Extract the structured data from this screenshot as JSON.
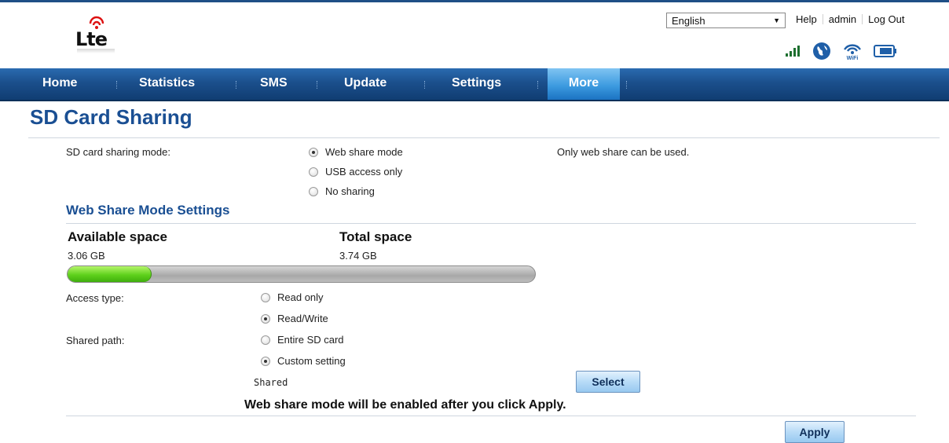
{
  "header": {
    "language": {
      "selected": "English"
    },
    "links": [
      "Help",
      "admin",
      "Log Out"
    ],
    "status_icons": [
      "signal-strength-icon",
      "internet-globe-icon",
      "wifi-icon",
      "battery-icon"
    ],
    "logo_icon": "lte-logo"
  },
  "nav": {
    "items": [
      {
        "label": "Home"
      },
      {
        "label": "Statistics"
      },
      {
        "label": "SMS"
      },
      {
        "label": "Update"
      },
      {
        "label": "Settings"
      },
      {
        "label": "More"
      }
    ],
    "active": "More"
  },
  "page": {
    "title": "SD Card Sharing",
    "sharing_mode": {
      "label": "SD card sharing mode:",
      "options": [
        "Web share mode",
        "USB access only",
        "No sharing"
      ],
      "selected": "Web share mode",
      "hint": "Only web share can be used."
    },
    "web_share": {
      "title": "Web Share Mode Settings",
      "available_label": "Available space",
      "available_value": "3.06 GB",
      "total_label": "Total space",
      "total_value": "3.74 GB",
      "used_fraction": 0.18,
      "access_type": {
        "label": "Access type:",
        "options": [
          "Read only",
          "Read/Write"
        ],
        "selected": "Read/Write"
      },
      "shared_path": {
        "label": "Shared path:",
        "options": [
          "Entire SD card",
          "Custom setting"
        ],
        "selected": "Custom setting",
        "value": "Shared"
      },
      "select_label": "Select"
    },
    "notice": "Web share mode will be enabled after you click Apply.",
    "apply_label": "Apply"
  },
  "colors": {
    "nav_bg": "#1b4f8c",
    "nav_active": "#3d9be0",
    "title": "#1a4f93",
    "bar_fill": "#5fd11c"
  }
}
